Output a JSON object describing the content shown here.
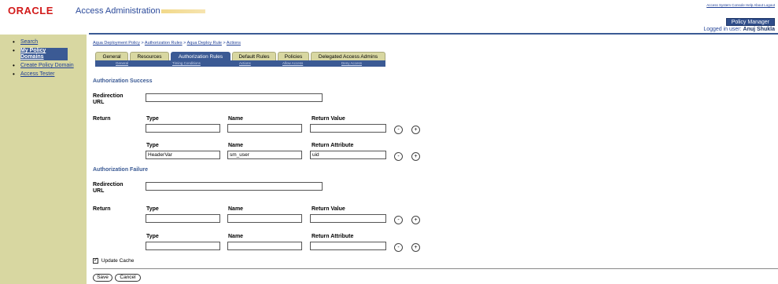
{
  "header": {
    "logo": "ORACLE",
    "app_title": "Access Administration",
    "top_links": "Access System Console Help About Logout",
    "policy_manager": "Policy Manager",
    "logged_in_prefix": "Logged in user:",
    "logged_in_user": "Anuj Shukla"
  },
  "sidebar": {
    "items": [
      {
        "label": "Search"
      },
      {
        "label": "My Policy Domains"
      },
      {
        "label": "Create Policy Domain"
      },
      {
        "label": "Access Tester"
      }
    ]
  },
  "breadcrumb": {
    "items": [
      "Aqua Deployment Policy",
      "Authorization Rules",
      "Aqua Deploy Rule",
      "Actions"
    ],
    "separator": ">"
  },
  "tabs": [
    {
      "label": "General"
    },
    {
      "label": "Resources"
    },
    {
      "label": "Authorization Rules"
    },
    {
      "label": "Default Rules"
    },
    {
      "label": "Policies"
    },
    {
      "label": "Delegated Access Admins"
    }
  ],
  "subtabs": [
    {
      "label": "General"
    },
    {
      "label": "Timing Conditions"
    },
    {
      "label": "Actions"
    },
    {
      "label": "Allow Access"
    },
    {
      "label": "Deny Access"
    }
  ],
  "success": {
    "title": "Authorization Success",
    "redirection_label": "Redirection URL",
    "redirection_value": "",
    "return_label": "Return",
    "row1": {
      "type_label": "Type",
      "name_label": "Name",
      "value_label": "Return Value",
      "type": "",
      "name": "",
      "value": ""
    },
    "row2": {
      "type_label": "Type",
      "name_label": "Name",
      "value_label": "Return Attribute",
      "type": "HeaderVar",
      "name": "sm_user",
      "value": "uid"
    }
  },
  "failure": {
    "title": "Authorization Failure",
    "redirection_label": "Redirection URL",
    "redirection_value": "",
    "return_label": "Return",
    "row1": {
      "type_label": "Type",
      "name_label": "Name",
      "value_label": "Return Value",
      "type": "",
      "name": "",
      "value": ""
    },
    "row2": {
      "type_label": "Type",
      "name_label": "Name",
      "value_label": "Return Attribute",
      "type": "",
      "name": "",
      "value": ""
    }
  },
  "buttons": {
    "minus": "-",
    "plus": "+",
    "save": "Save",
    "cancel": "Cancel"
  },
  "update_cache": {
    "label": "Update Cache",
    "checked": true
  },
  "colors": {
    "accent": "#3b5a94",
    "sidebar": "#d8d7a1",
    "brand": "#d21a1a"
  }
}
